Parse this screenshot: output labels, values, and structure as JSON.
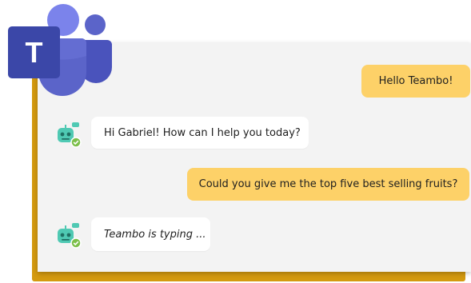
{
  "app": {
    "name": "Microsoft Teams",
    "logo_letter": "T",
    "colors": {
      "brand_dark": "#3b47a8",
      "brand_mid": "#5b64c9",
      "brand_light": "#7b83eb",
      "user_bubble": "#fdd168",
      "bot_bubble": "#ffffff",
      "frame": "#d49a0f",
      "bot_avatar": "#4fc9b3",
      "status_online": "#7cbf4a"
    }
  },
  "chat": {
    "messages": [
      {
        "sender": "user",
        "text": "Hello Teambo!"
      },
      {
        "sender": "bot",
        "text": "Hi Gabriel! How can I help you today?",
        "avatar_icon": "robot-avatar-icon"
      },
      {
        "sender": "user",
        "text": "Could you give me the top five best selling fruits?"
      },
      {
        "sender": "bot",
        "text": "Teambo is typing ...",
        "avatar_icon": "robot-avatar-icon"
      }
    ]
  }
}
